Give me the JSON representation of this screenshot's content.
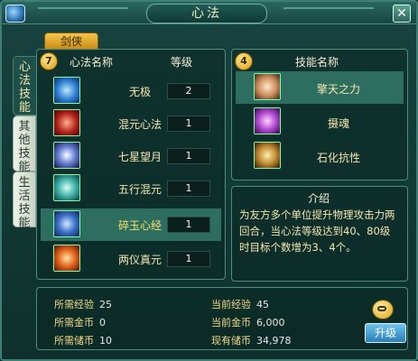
{
  "window": {
    "title": "心法"
  },
  "tabs": {
    "top": "剑侠",
    "side": [
      "心法技能",
      "其他技能",
      "生活技能"
    ]
  },
  "left_panel": {
    "badge": "7",
    "col_name": "心法名称",
    "col_level": "等级",
    "rows": [
      {
        "name": "无极",
        "level": "2",
        "selected": false
      },
      {
        "name": "混元心法",
        "level": "1",
        "selected": false
      },
      {
        "name": "七星望月",
        "level": "1",
        "selected": false
      },
      {
        "name": "五行混元",
        "level": "1",
        "selected": false
      },
      {
        "name": "碎玉心经",
        "level": "1",
        "selected": true
      },
      {
        "name": "两仪真元",
        "level": "1",
        "selected": false
      }
    ]
  },
  "skills_panel": {
    "badge": "4",
    "header": "技能名称",
    "rows": [
      {
        "name": "擎天之力",
        "selected": true
      },
      {
        "name": "摄魂",
        "selected": false
      },
      {
        "name": "石化抗性",
        "selected": false
      }
    ]
  },
  "intro": {
    "title": "介绍",
    "text": "为友方多个单位提升物理攻击力两回合，当心法等级达到40、80级时目标个数增为3、4个。"
  },
  "stats": {
    "req_exp_label": "所需经验",
    "req_exp": "25",
    "req_gold_label": "所需金币",
    "req_gold": "0",
    "req_reserve_label": "所需储币",
    "req_reserve": "10",
    "cur_exp_label": "当前经验",
    "cur_exp": "45",
    "cur_gold_label": "当前金币",
    "cur_gold": "6,000",
    "cur_reserve_label": "现有储币",
    "cur_reserve": "34,978"
  },
  "upgrade_button": "升级"
}
